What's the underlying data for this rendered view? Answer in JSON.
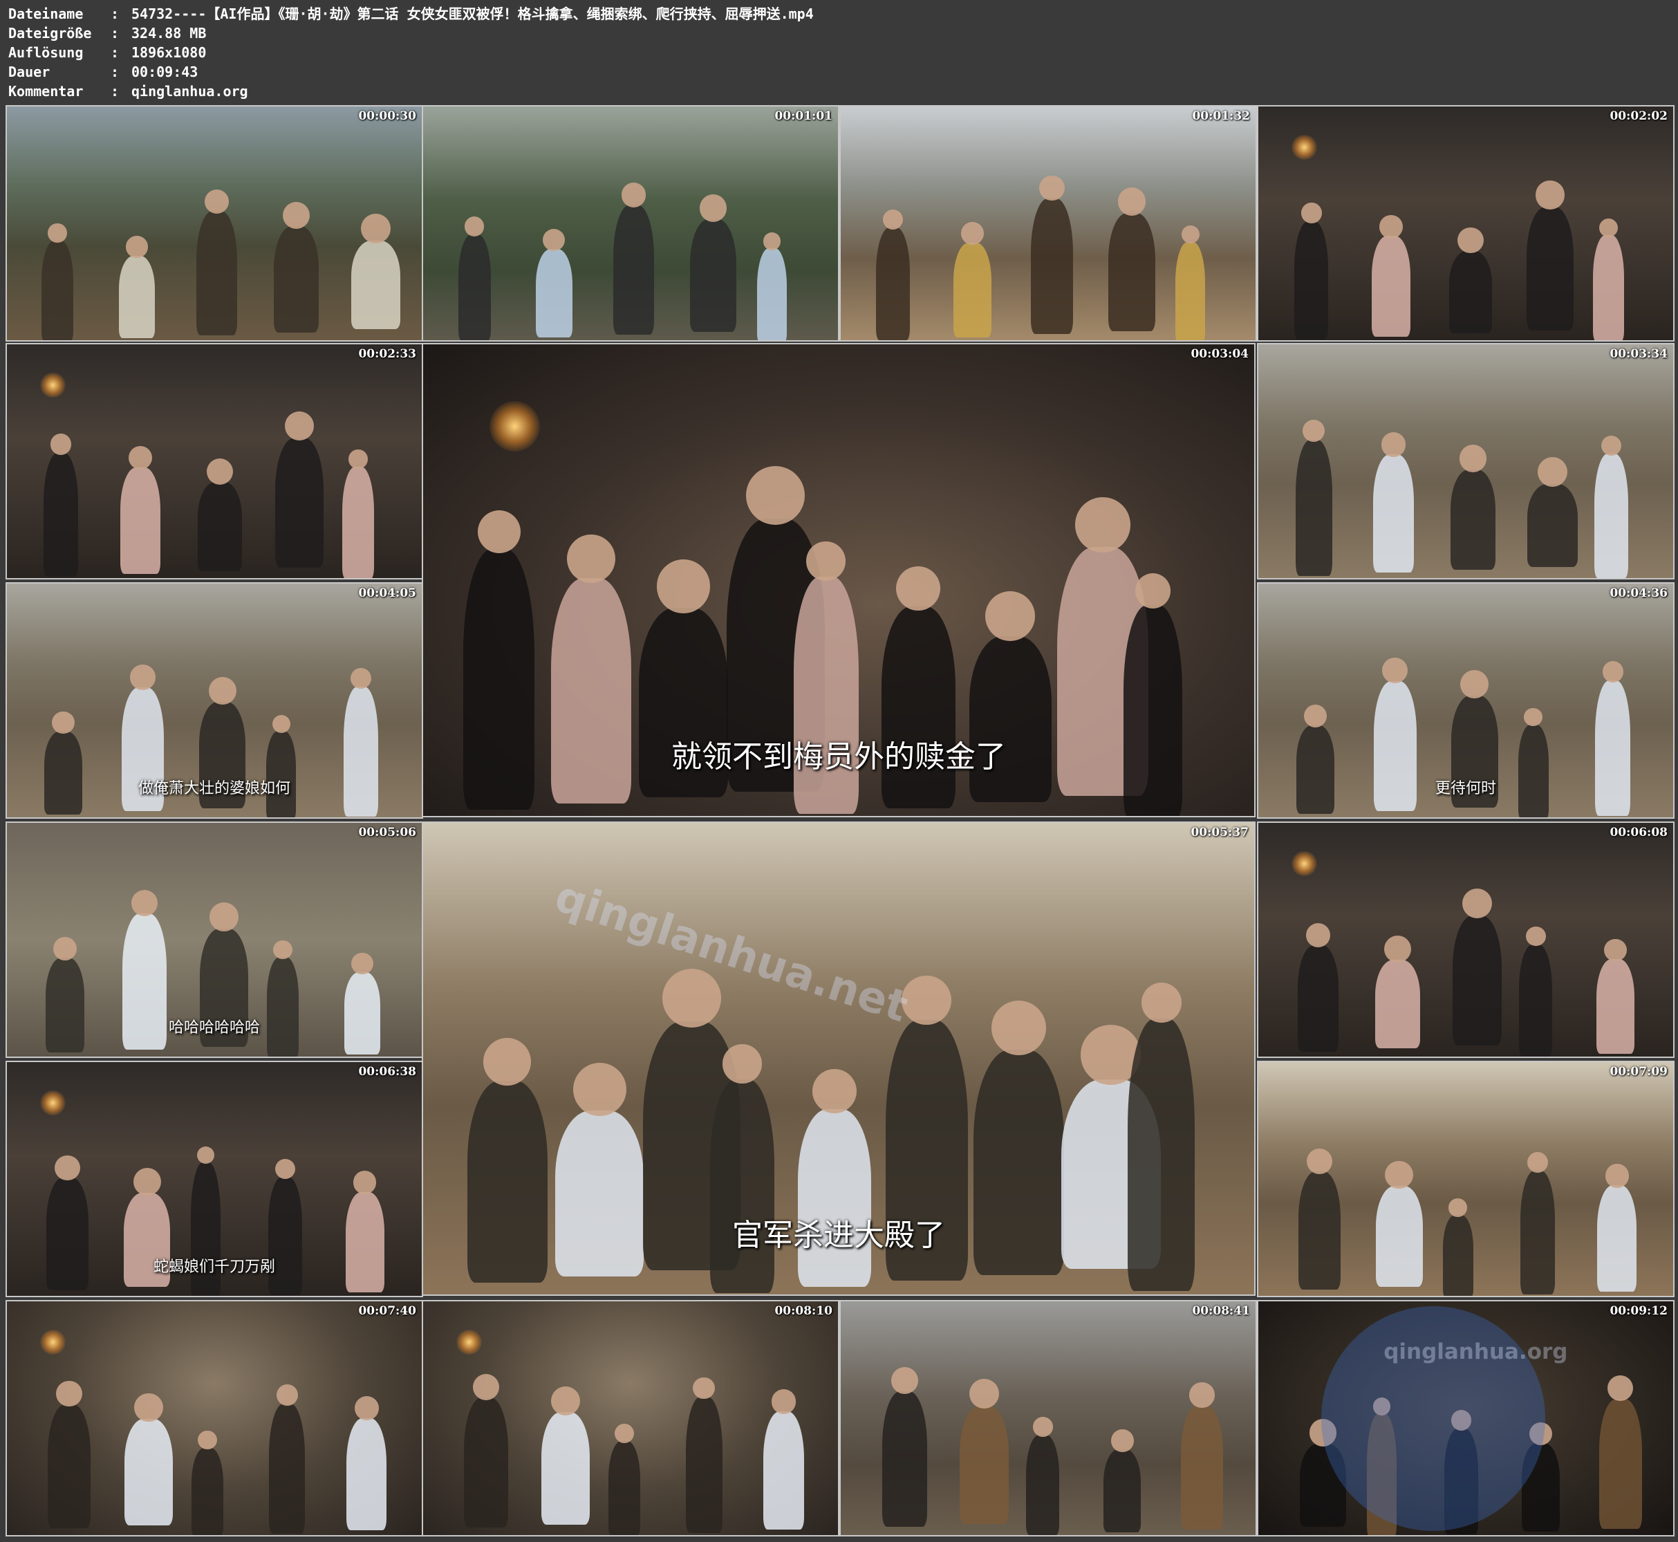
{
  "info": {
    "rows": [
      {
        "key": "Dateiname",
        "sep": ":",
        "value": "54732----【AI作品】《珊·胡·劫》第二话 女侠女匪双被俘！格斗擒拿、绳捆索绑、爬行挟持、屈辱押送.mp4"
      },
      {
        "key": "Dateigröße",
        "sep": ":",
        "value": "324.88 MB"
      },
      {
        "key": "Auflösung",
        "sep": ":",
        "value": "1896x1080"
      },
      {
        "key": "Dauer",
        "sep": ":",
        "value": "00:09:43"
      },
      {
        "key": "Kommentar",
        "sep": ":",
        "value": "qinglanhua.org"
      }
    ]
  },
  "thumbnails": [
    {
      "time": "00:00:30",
      "subtitle": "",
      "mood": "mountain-road"
    },
    {
      "time": "00:01:01",
      "subtitle": "",
      "mood": "forest-path"
    },
    {
      "time": "00:01:32",
      "subtitle": "",
      "mood": "village-cavalry"
    },
    {
      "time": "00:02:02",
      "subtitle": "",
      "mood": "dungeon"
    },
    {
      "time": "00:02:33",
      "subtitle": "",
      "mood": "dungeon"
    },
    {
      "time": "00:03:04",
      "subtitle": "就领不到梅员外的赎金了",
      "mood": "dungeon-close"
    },
    {
      "time": "00:03:34",
      "subtitle": "",
      "mood": "village-fight"
    },
    {
      "time": "00:04:05",
      "subtitle": "做俺萧大壮的婆娘如何",
      "mood": "village-fight"
    },
    {
      "time": "00:04:36",
      "subtitle": "更待何时",
      "mood": "village-fight"
    },
    {
      "time": "00:05:06",
      "subtitle": "哈哈哈哈哈哈",
      "mood": "ground-close"
    },
    {
      "time": "00:05:37",
      "subtitle": "官军杀进大殿了",
      "mood": "village-dusk"
    },
    {
      "time": "00:06:08",
      "subtitle": "",
      "mood": "dungeon"
    },
    {
      "time": "00:06:38",
      "subtitle": "蛇蝎娘们千刀万剐",
      "mood": "dungeon"
    },
    {
      "time": "00:07:09",
      "subtitle": "",
      "mood": "village-dusk"
    },
    {
      "time": "00:07:40",
      "subtitle": "",
      "mood": "tunnel"
    },
    {
      "time": "00:08:10",
      "subtitle": "",
      "mood": "tunnel"
    },
    {
      "time": "00:08:41",
      "subtitle": "",
      "mood": "cage-street"
    },
    {
      "time": "00:09:12",
      "subtitle": "",
      "mood": "cage-close"
    }
  ],
  "watermarks": {
    "large_tile": "qinglanhua.net",
    "last_tile": "qinglanhua.org"
  },
  "colors": {
    "background": "#3a3a3a",
    "text": "#ffffff",
    "border": "#c8c8c8"
  }
}
